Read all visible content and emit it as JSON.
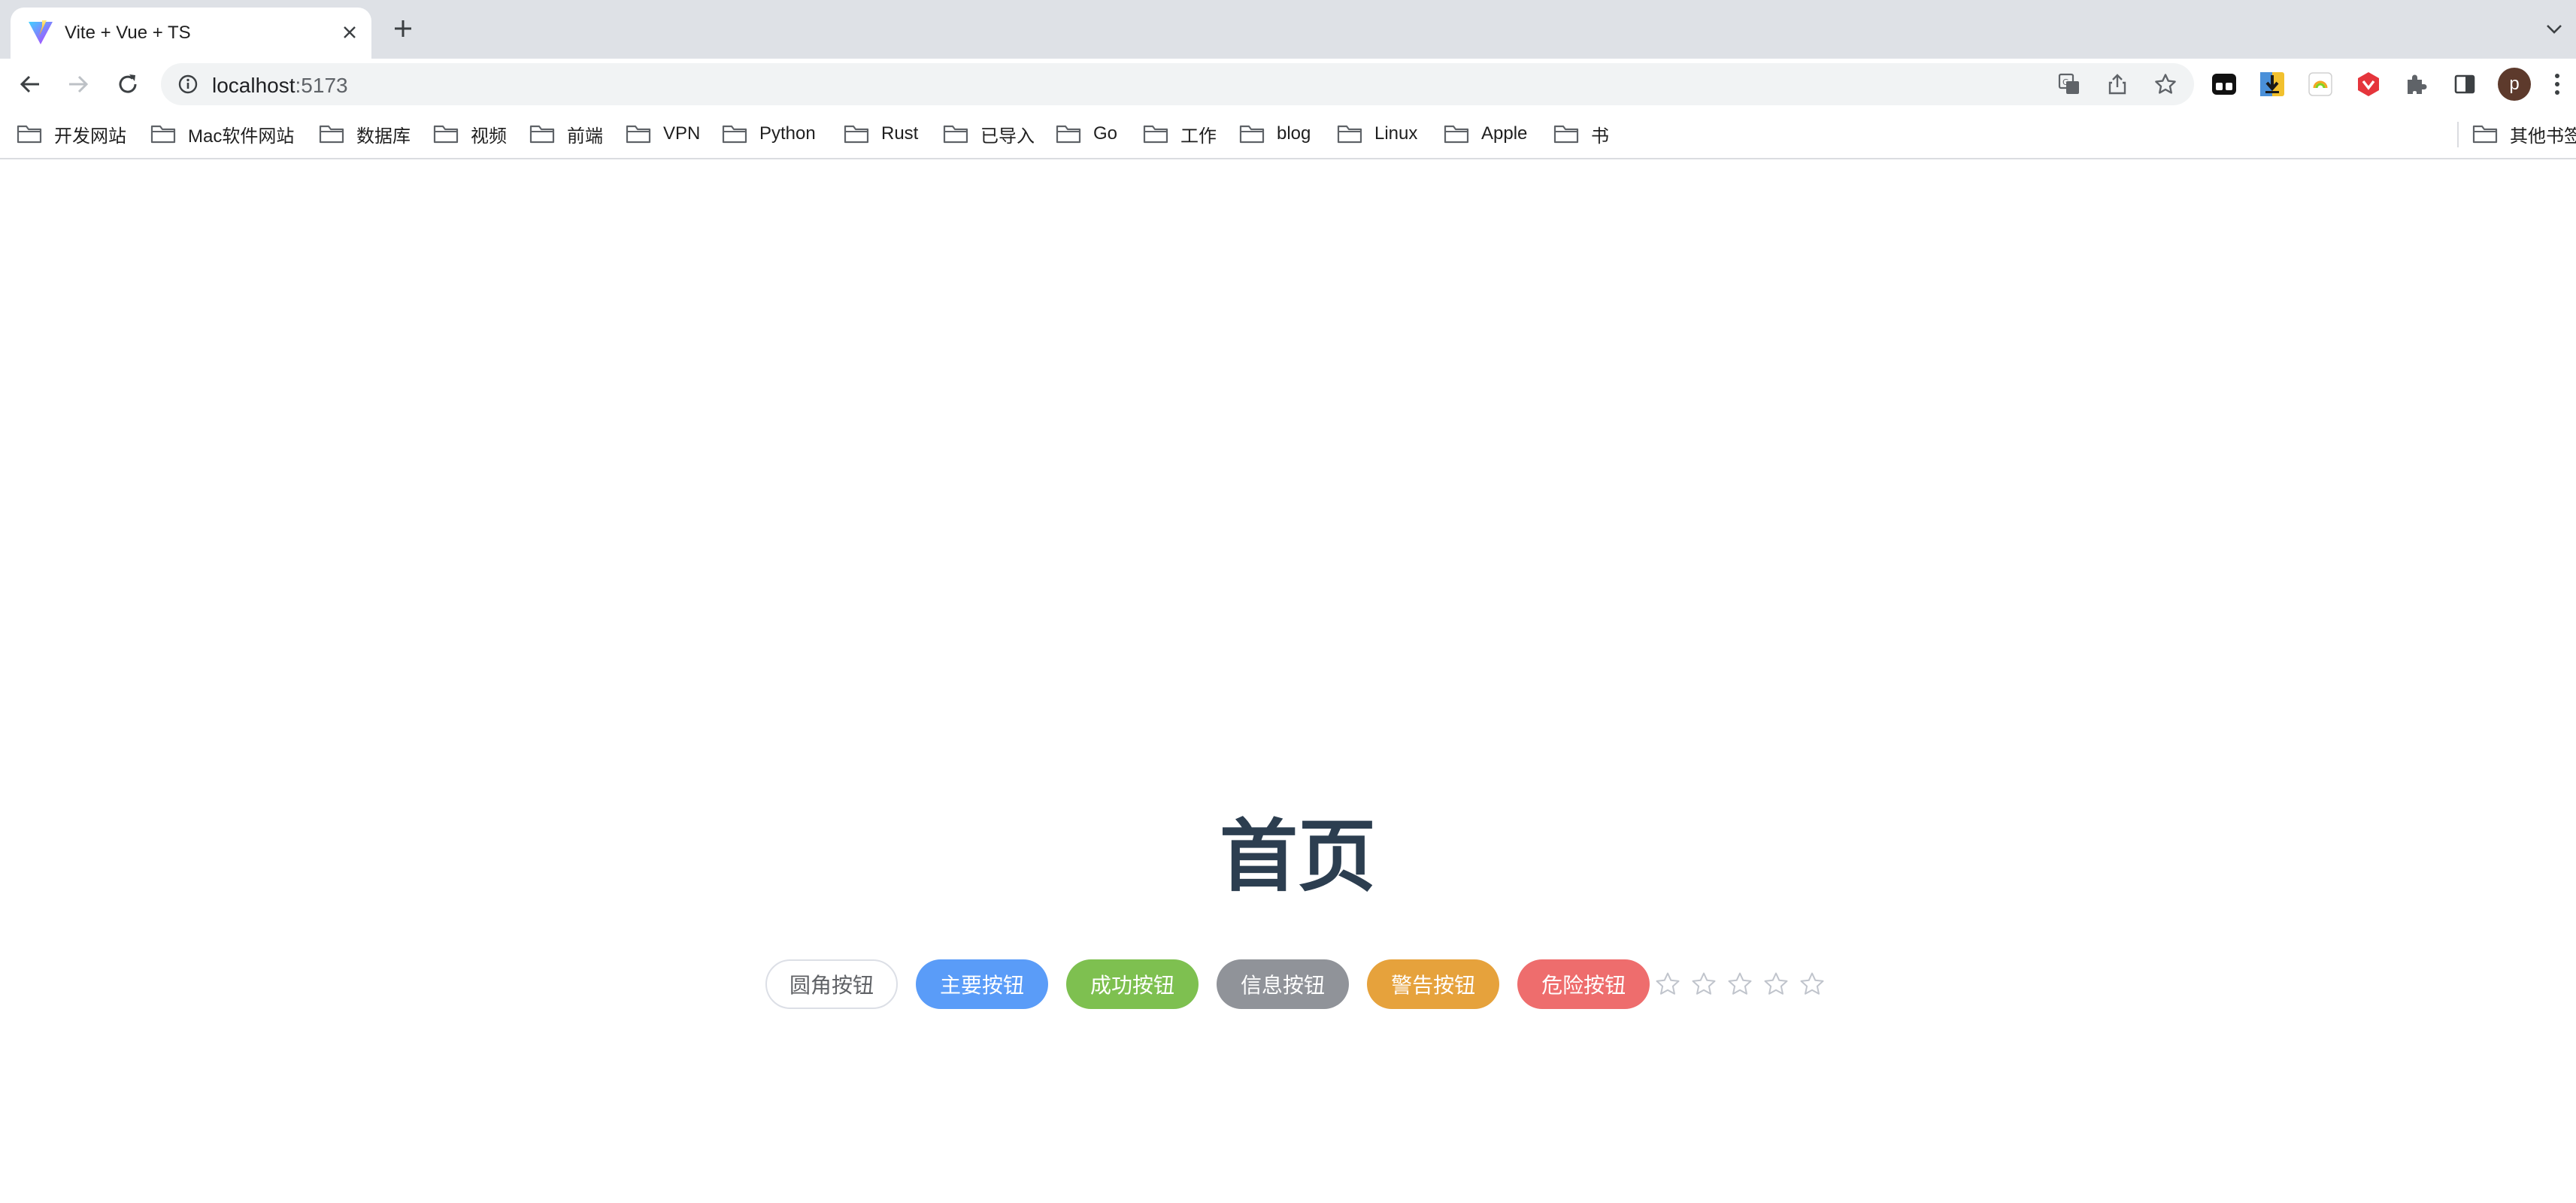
{
  "browser": {
    "tab": {
      "title": "Vite + Vue + TS"
    },
    "url": {
      "host": "localhost",
      "port": ":5173"
    },
    "profile_initial": "p"
  },
  "bookmarks": [
    {
      "label": "开发网站"
    },
    {
      "label": "Mac软件网站"
    },
    {
      "label": "数据库"
    },
    {
      "label": "视频"
    },
    {
      "label": "前端"
    },
    {
      "label": "VPN"
    },
    {
      "label": "Python"
    },
    {
      "label": "Rust"
    },
    {
      "label": "已导入"
    },
    {
      "label": "Go"
    },
    {
      "label": "工作"
    },
    {
      "label": "blog"
    },
    {
      "label": "Linux"
    },
    {
      "label": "Apple"
    },
    {
      "label": "书"
    }
  ],
  "other_bookmarks": "其他书签",
  "page": {
    "title": "首页",
    "buttons": [
      {
        "label": "圆角按钮",
        "type": "plain"
      },
      {
        "label": "主要按钮",
        "type": "primary"
      },
      {
        "label": "成功按钮",
        "type": "success"
      },
      {
        "label": "信息按钮",
        "type": "info"
      },
      {
        "label": "警告按钮",
        "type": "warning"
      },
      {
        "label": "危险按钮",
        "type": "danger"
      }
    ],
    "rating": {
      "value": 0,
      "max": 5
    }
  },
  "colors": {
    "primary": "#5a9cf8",
    "success": "#7ec050",
    "info": "#909399",
    "warning": "#e6a23c",
    "danger": "#ee6d6d",
    "title": "#2c3e50"
  }
}
